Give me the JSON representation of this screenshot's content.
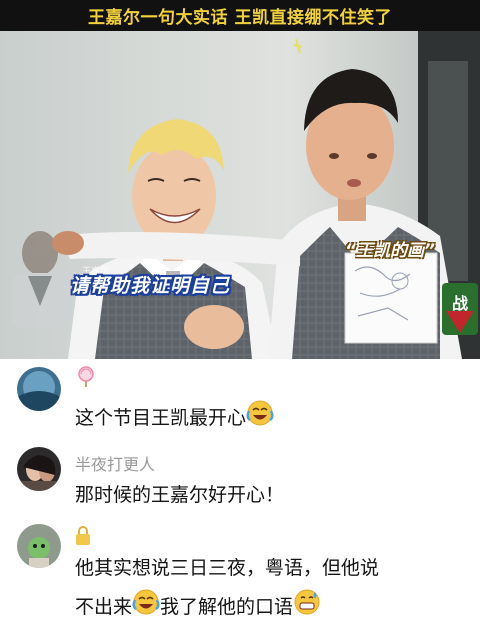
{
  "banner": {
    "title": "王嘉尔一句大实话 王凯直接绷不住笑了"
  },
  "video": {
    "caption": "请帮助我证明自己",
    "sign_title": "“王凯的画”",
    "person_name": "王嘉尔",
    "show_logo_text": "战",
    "colors": {
      "banner_text": "#f2d23a",
      "caption_outline": "#1b3f9c"
    }
  },
  "comments": [
    {
      "username": "",
      "badge_icon": "lollipop-icon",
      "text": "这个节目王凯最开心",
      "emoji": "laughing-crying-emoji"
    },
    {
      "username": "半夜打更人",
      "text": "那时候的王嘉尔好开心！"
    },
    {
      "username": "",
      "badge_icon": "lock-icon",
      "text_line1": "他其实想说三日三夜，粤语，但他说",
      "text_line2a": "不出来",
      "text_line2b": "我了解他的口语",
      "emoji": "laughing-crying-emoji",
      "emoji2": "grinning-sweat-emoji"
    }
  ]
}
